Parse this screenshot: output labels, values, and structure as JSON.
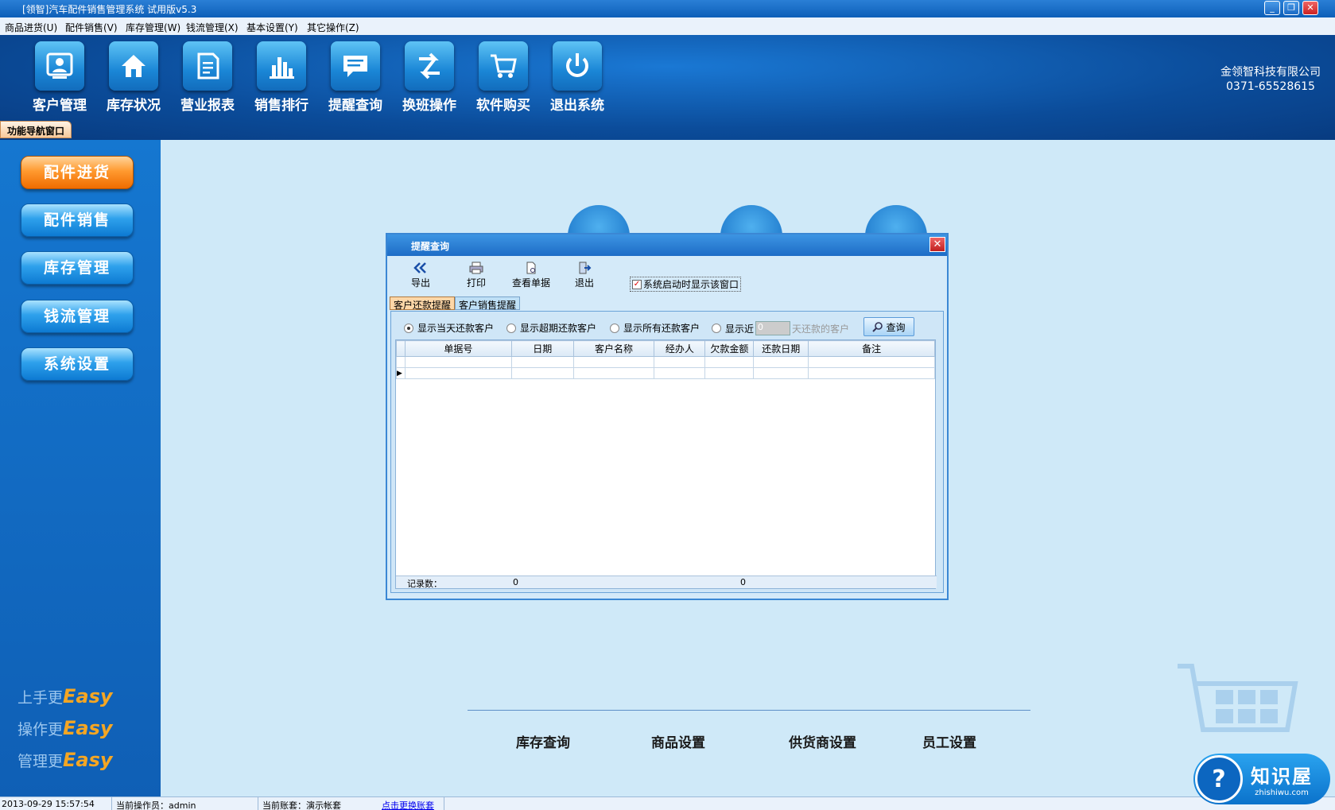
{
  "window": {
    "title": "[领智]汽车配件销售管理系统 试用版v5.3",
    "minimize": "_",
    "restore": "❐",
    "close": "✕"
  },
  "menu": [
    "商品进货(U)",
    "配件销售(V)",
    "库存管理(W)",
    "钱流管理(X)",
    "基本设置(Y)",
    "其它操作(Z)"
  ],
  "toolbar": [
    {
      "label": "客户管理",
      "icon": "customer-icon"
    },
    {
      "label": "库存状况",
      "icon": "home-icon"
    },
    {
      "label": "营业报表",
      "icon": "report-icon"
    },
    {
      "label": "销售排行",
      "icon": "bar-chart-icon"
    },
    {
      "label": "提醒查询",
      "icon": "message-icon"
    },
    {
      "label": "换班操作",
      "icon": "shift-icon"
    },
    {
      "label": "软件购买",
      "icon": "cart-icon"
    },
    {
      "label": "退出系统",
      "icon": "power-icon"
    }
  ],
  "company": {
    "name": "金领智科技有限公司",
    "phone": "0371-65528615"
  },
  "nav_tab": "功能导航窗口",
  "left_nav": [
    "配件进货",
    "配件销售",
    "库存管理",
    "钱流管理",
    "系统设置"
  ],
  "slogans": [
    {
      "prefix": "上手更",
      "word": "Easy"
    },
    {
      "prefix": "操作更",
      "word": "Easy"
    },
    {
      "prefix": "管理更",
      "word": "Easy"
    }
  ],
  "bottom_links": [
    "库存查询",
    "商品设置",
    "供货商设置",
    "员工设置"
  ],
  "dialog": {
    "title": "提醒查询",
    "close": "✕",
    "tools": [
      "导出",
      "打印",
      "查看单据",
      "退出"
    ],
    "startup_checkbox": "系统启动时显示该窗口",
    "startup_checked": true,
    "tabs": [
      "客户还款提醒",
      "客户销售提醒"
    ],
    "filters": {
      "today": "显示当天还款客户",
      "overdue": "显示超期还款客户",
      "all": "显示所有还款客户",
      "recent_prefix": "显示近",
      "days_value": "0",
      "recent_suffix": "天还款的客户",
      "query_button": "查询"
    },
    "columns": [
      "单据号",
      "日期",
      "客户名称",
      "经办人",
      "欠款金额",
      "还款日期",
      "备注"
    ],
    "footer": {
      "label": "记录数：",
      "count": "0",
      "amount": "0"
    }
  },
  "status_bar": {
    "datetime": "2013-09-29 15:57:54",
    "operator": "当前操作员：admin",
    "account": "当前账套：演示帐套",
    "switch_link": "点击更换账套"
  },
  "watermark": {
    "name": "知识屋",
    "url": "zhishiwu.com"
  }
}
